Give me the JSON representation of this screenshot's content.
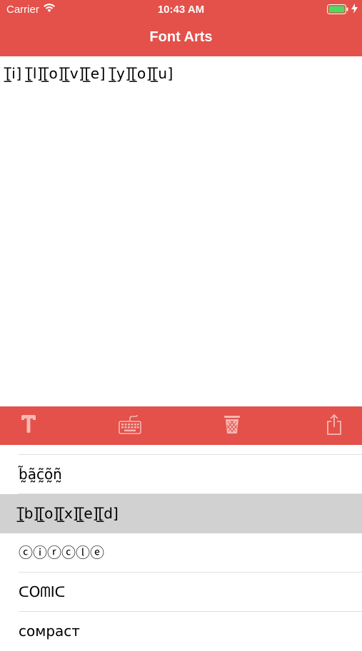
{
  "status_bar": {
    "carrier": "Carrier",
    "time": "10:43 AM"
  },
  "nav": {
    "title": "Font Arts"
  },
  "editor": {
    "text": "[̲̅i] [̲̅l][̲̅o][̲̅v][̲̅e] [̲̅y][̲̅o][̲̅u]"
  },
  "toolbar": {
    "items": [
      {
        "icon": "text-style-icon"
      },
      {
        "icon": "keyboard-icon"
      },
      {
        "icon": "trash-icon"
      },
      {
        "icon": "share-icon"
      }
    ]
  },
  "font_list": {
    "items": [
      {
        "label": "b̰̃ã̰c̰̃õ̰ñ̰",
        "selected": false
      },
      {
        "label": "[̲̅b][̲̅o][̲̅x][̲̅e][̲̅d]",
        "selected": true
      },
      {
        "label": "ⓒⓘⓡⓒⓛⓔ",
        "selected": false
      },
      {
        "label": "ᑕOᗰIᑕ",
        "selected": false
      },
      {
        "label": "сомраст",
        "selected": false
      }
    ]
  },
  "colors": {
    "accent": "#e3514a",
    "selected_row": "#d1d1d1",
    "icon": "#f5b8b4"
  }
}
